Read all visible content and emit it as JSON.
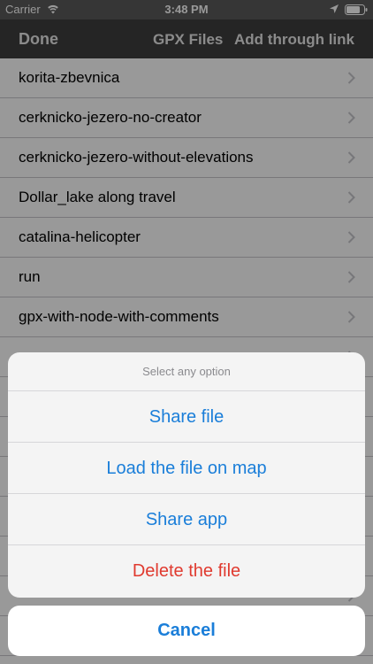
{
  "status_bar": {
    "carrier": "Carrier",
    "time": "3:48 PM"
  },
  "nav": {
    "done_label": "Done",
    "title": "GPX Files",
    "add_label": "Add through link"
  },
  "files": [
    "korita-zbevnica",
    "cerknicko-jezero-no-creator",
    "cerknicko-jezero-without-elevations",
    "Dollar_lake along travel",
    "catalina-helicopter",
    "run",
    "gpx-with-node-with-comments",
    "",
    "",
    "",
    "",
    "",
    "",
    "",
    "",
    "",
    ""
  ],
  "action_sheet": {
    "title": "Select any option",
    "actions": [
      "Share file",
      "Load the file on map",
      "Share app",
      "Delete the file"
    ],
    "cancel_label": "Cancel"
  },
  "colors": {
    "accent": "#1a7ed9",
    "destructive": "#e03a2f",
    "nav_bg": "#3f3f3f"
  }
}
